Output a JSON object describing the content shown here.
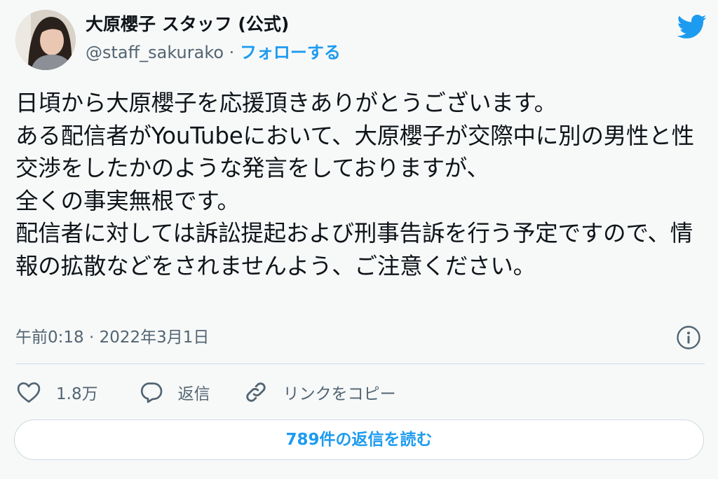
{
  "author": {
    "display_name": "大原櫻子 スタッフ (公式)",
    "handle": "@staff_sakurako",
    "separator": " · ",
    "follow_label": "フォローする"
  },
  "icons": {
    "brand": "twitter-bird-icon",
    "info": "info-icon",
    "like": "heart-icon",
    "reply": "speech-bubble-icon",
    "copy_link": "link-icon"
  },
  "colors": {
    "accent": "#1d9bf0",
    "secondary_text": "#536471",
    "background": "#f7f9f9",
    "border": "#cfd9de"
  },
  "tweet": {
    "text": "日頃から大原櫻子を応援頂きありがとうございます。\nある配信者がYouTubeにおいて、大原櫻子が交際中に別の男性と性交渉をしたかのような発言をしておりますが、\n全くの事実無根です。\n配信者に対しては訴訟提起および刑事告訴を行う予定ですので、情報の拡散などをされませんよう、ご注意ください。",
    "timestamp": "午前0:18 · 2022年3月1日"
  },
  "actions": {
    "like_count": "1.8万",
    "reply_label": "返信",
    "copy_link_label": "リンクをコピー"
  },
  "replies_button_label": "789件の返信を読む"
}
